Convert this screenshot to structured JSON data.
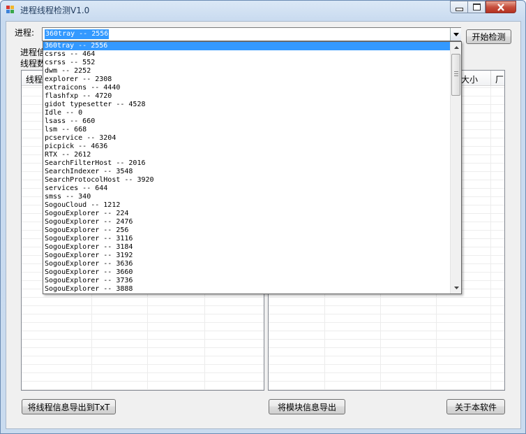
{
  "window": {
    "title": "进程线程检测V1.0",
    "icons": {
      "app": "app-icon",
      "minimize": "minimize-icon",
      "maximize": "maximize-icon",
      "close": "close-icon"
    }
  },
  "process": {
    "label": "进程:",
    "selected": "360tray -- 2556",
    "start_button": "开始检测"
  },
  "left_panel": {
    "group_label_partial": "进程信",
    "thread_label_partial": "线程数",
    "header_partial": "线程"
  },
  "right_panel": {
    "header_partial_size": "大小",
    "header_partial_vendor": "厂"
  },
  "dropdown": {
    "items": [
      "360tray -- 2556",
      "csrss -- 464",
      "csrss -- 552",
      "dwm -- 2252",
      "explorer -- 2308",
      "extraicons -- 4440",
      "flashfxp -- 4720",
      "gidot typesetter -- 4528",
      "Idle -- 0",
      "lsass -- 660",
      "lsm -- 668",
      "pcservice -- 3204",
      "picpick -- 4636",
      "RTX -- 2612",
      "SearchFilterHost -- 2016",
      "SearchIndexer -- 3548",
      "SearchProtocolHost -- 3920",
      "services -- 644",
      "smss -- 340",
      "SogouCloud -- 1212",
      "SogouExplorer -- 224",
      "SogouExplorer -- 2476",
      "SogouExplorer -- 256",
      "SogouExplorer -- 3116",
      "SogouExplorer -- 3184",
      "SogouExplorer -- 3192",
      "SogouExplorer -- 3636",
      "SogouExplorer -- 3660",
      "SogouExplorer -- 3736",
      "SogouExplorer -- 3888"
    ],
    "selected_index": 0
  },
  "buttons": {
    "export_threads": "将线程信息导出到TxT",
    "export_modules": "将模块信息导出",
    "about": "关于本软件"
  },
  "colors": {
    "selection": "#3399ff",
    "close_button": "#c7503f"
  }
}
